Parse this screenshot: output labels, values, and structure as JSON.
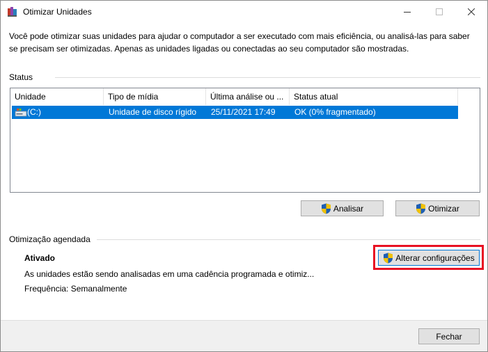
{
  "window": {
    "title": "Otimizar Unidades"
  },
  "intro": "Você pode otimizar suas unidades para ajudar o computador a ser executado com mais eficiência, ou analisá-las para saber se precisam ser otimizadas. Apenas as unidades ligadas ou conectadas ao seu computador são mostradas.",
  "status": {
    "label": "Status",
    "columns": [
      "Unidade",
      "Tipo de mídia",
      "Última análise ou ...",
      "Status atual"
    ],
    "rows": [
      {
        "drive": "(C:)",
        "media_type": "Unidade de disco rígido",
        "last_analysis": "25/11/2021 17:49",
        "status": "OK (0% fragmentado)"
      }
    ],
    "analyze_label": "Analisar",
    "optimize_label": "Otimizar"
  },
  "schedule": {
    "label": "Otimização agendada",
    "state": "Ativado",
    "description": "As unidades estão sendo analisadas em uma cadência programada e otimiz...",
    "frequency": "Frequência: Semanalmente",
    "change_settings_label": "Alterar configurações"
  },
  "footer": {
    "close_label": "Fechar"
  },
  "colors": {
    "selection": "#0078d7",
    "highlight_border": "#e81123"
  }
}
